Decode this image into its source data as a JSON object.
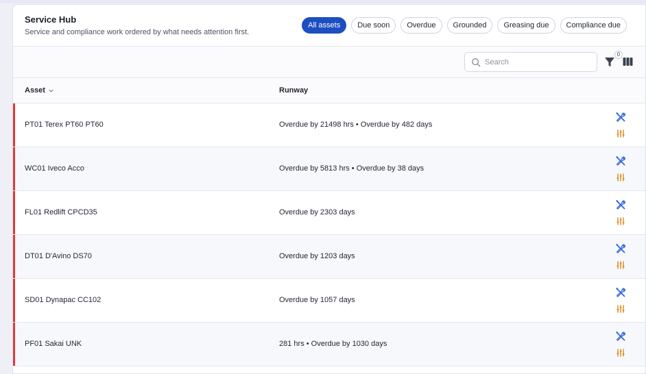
{
  "header": {
    "title": "Service Hub",
    "subtitle": "Service and compliance work ordered by what needs attention first."
  },
  "filters": {
    "chips": [
      {
        "label": "All assets",
        "active": true
      },
      {
        "label": "Due soon",
        "active": false
      },
      {
        "label": "Overdue",
        "active": false
      },
      {
        "label": "Grounded",
        "active": false
      },
      {
        "label": "Greasing due",
        "active": false
      },
      {
        "label": "Compliance due",
        "active": false
      }
    ]
  },
  "toolbar": {
    "search_placeholder": "Search",
    "search_value": "",
    "filter_count": "0",
    "icons": {
      "search": "search-icon",
      "filter": "filter-icon",
      "columns": "columns-icon"
    }
  },
  "table": {
    "columns": {
      "asset": "Asset",
      "runway": "Runway"
    },
    "accent_color": "#e0393e",
    "rows": [
      {
        "asset": "PT01 Terex PT60 PT60",
        "runway": "Overdue by 21498 hrs • Overdue by 482 days"
      },
      {
        "asset": "WC01 Iveco Acco",
        "runway": "Overdue by 5813 hrs • Overdue by 38 days"
      },
      {
        "asset": "FL01 Redlift CPCD35",
        "runway": "Overdue by 2303 days"
      },
      {
        "asset": "DT01 D'Avino DS70",
        "runway": "Overdue by 1203 days"
      },
      {
        "asset": "SD01 Dynapac CC102",
        "runway": "Overdue by 1057 days"
      },
      {
        "asset": "PF01 Sakai UNK",
        "runway": "281 hrs • Overdue by 1030 days"
      }
    ],
    "row_actions": {
      "service": "wrench-screwdriver-icon",
      "greasing": "grease-gun-icon"
    }
  },
  "colors": {
    "primary": "#1d4fc2",
    "service_icon": "#2f66d8",
    "grease_icon": "#d98a1c",
    "overdue_accent": "#e0393e"
  }
}
